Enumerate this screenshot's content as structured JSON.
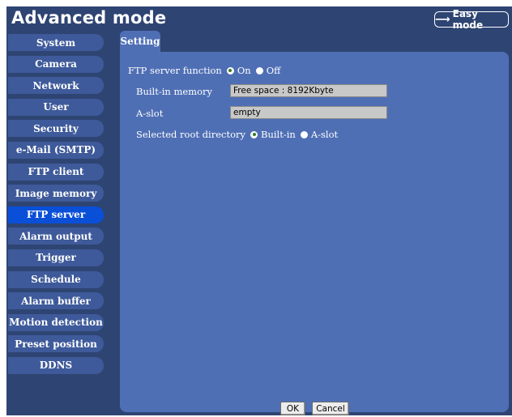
{
  "header": {
    "title": "Advanced mode",
    "easy_mode_label": "Easy mode",
    "easy_mode_icon": "arrow-right-icon"
  },
  "sidebar": {
    "items": [
      {
        "label": "System"
      },
      {
        "label": "Camera"
      },
      {
        "label": "Network"
      },
      {
        "label": "User"
      },
      {
        "label": "Security"
      },
      {
        "label": "e-Mail (SMTP)"
      },
      {
        "label": "FTP client"
      },
      {
        "label": "Image memory"
      },
      {
        "label": "FTP server",
        "active": true
      },
      {
        "label": "Alarm output"
      },
      {
        "label": "Trigger"
      },
      {
        "label": "Schedule"
      },
      {
        "label": "Alarm buffer"
      },
      {
        "label": "Motion detection"
      },
      {
        "label": "Preset position"
      },
      {
        "label": "DDNS"
      }
    ]
  },
  "main": {
    "tab_label": "Setting",
    "ftp_function": {
      "label": "FTP server function",
      "options": [
        "On",
        "Off"
      ],
      "selected": "On"
    },
    "builtin_memory": {
      "label": "Built-in memory",
      "value": "Free space : 8192Kbyte"
    },
    "a_slot": {
      "label": "A-slot",
      "value": "empty"
    },
    "root_directory": {
      "label": "Selected root directory",
      "options": [
        "Built-in",
        "A-slot"
      ],
      "selected": "Built-in"
    },
    "ok_label": "OK",
    "cancel_label": "Cancel"
  },
  "colors": {
    "background": "#2e4472",
    "panel": "#4f6fb5",
    "nav_item": "#3e5a9a",
    "nav_active": "#0a4fd8"
  }
}
